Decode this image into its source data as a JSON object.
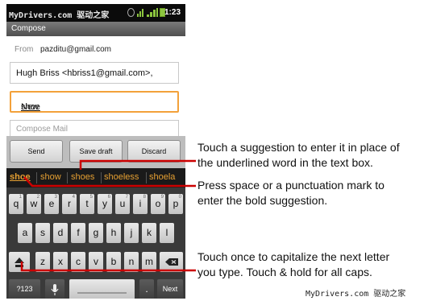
{
  "status_bar": {
    "watermark": "MyDrivers.com 驱动之家",
    "time": "1:23",
    "icons": [
      "sync-icon",
      "wifi-icon",
      "signal-icon",
      "battery-icon"
    ],
    "accent_color": "#8dc63f"
  },
  "title_bar": {
    "title": "Compose"
  },
  "compose": {
    "from_label": "From",
    "from_value": "pazditu@gmail.com",
    "to_value": "Hugh Briss <hbriss1@gmail.com>,",
    "subject_prefix": "New ",
    "subject_word": "shoe",
    "body_placeholder": "Compose Mail",
    "focus_color": "#f3a13a"
  },
  "actions": {
    "send": "Send",
    "save_draft": "Save draft",
    "discard": "Discard"
  },
  "suggestions": [
    "shoe",
    "show",
    "shoes",
    "shoeless",
    "shoela"
  ],
  "suggestion_color": "#e6a032",
  "keyboard": {
    "row1": [
      "q",
      "w",
      "e",
      "r",
      "t",
      "y",
      "u",
      "i",
      "o",
      "p"
    ],
    "row1_hints": [
      "1",
      "2",
      "3",
      "4",
      "5",
      "6",
      "7",
      "8",
      "9",
      "0"
    ],
    "row2": [
      "a",
      "s",
      "d",
      "f",
      "g",
      "h",
      "j",
      "k",
      "l"
    ],
    "row3": [
      "z",
      "x",
      "c",
      "v",
      "b",
      "n",
      "m"
    ],
    "symbols_key": "?123",
    "period_key": ".",
    "next_key": "Next"
  },
  "callouts": {
    "suggestion_line1": "Touch a suggestion to enter it in place of",
    "suggestion_line2": "the underlined word in the text box.",
    "space_line1": "Press space or a punctuation mark to",
    "space_line2": "enter the bold suggestion.",
    "shift_line1": "Touch once to capitalize the next letter",
    "shift_line2": "you type. Touch & hold for all caps.",
    "leader_color": "#cc0000"
  },
  "footer_watermark": "MyDrivers.com 驱动之家"
}
